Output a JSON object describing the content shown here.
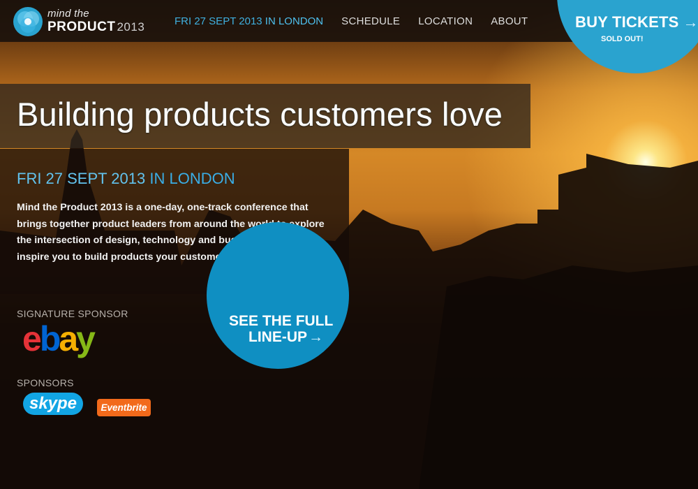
{
  "colors": {
    "accent_blue": "#2aa3cf",
    "nav_date_blue": "#3fb0e0",
    "lineup_blue": "#0f8fc2",
    "skype_blue": "#12a5e4",
    "eventbrite_orange": "#f26a1b"
  },
  "logo": {
    "icon": "mind-the-product-logo-icon",
    "line1": "mind the",
    "line2": "PRODUCT",
    "year": "2013"
  },
  "nav": {
    "date": "FRI 27 SEPT 2013",
    "location": "IN LONDON",
    "items": [
      "SCHEDULE",
      "LOCATION",
      "ABOUT"
    ]
  },
  "buy_tickets": {
    "label": "BUY TICKETS",
    "arrow": "→",
    "sub": "SOLD OUT!"
  },
  "hero": {
    "headline": "Building products customers love",
    "date": "FRI 27 SEPT 2013",
    "location": "IN LONDON",
    "description": "Mind the Product 2013 is a one-day, one-track conference that brings together product leaders from around the world to explore the intersection of design, technology and business in order to inspire you to build products your customers love."
  },
  "lineup_button": {
    "line1": "SEE THE FULL",
    "line2": "LINE-UP",
    "arrow": "→"
  },
  "sponsors": {
    "signature_heading": "SIGNATURE SPONSOR",
    "signature": {
      "e": "e",
      "b": "b",
      "a": "a",
      "y": "y"
    },
    "heading": "SPONSORS",
    "skype": "skype",
    "eventbrite": "Eventbrite"
  }
}
